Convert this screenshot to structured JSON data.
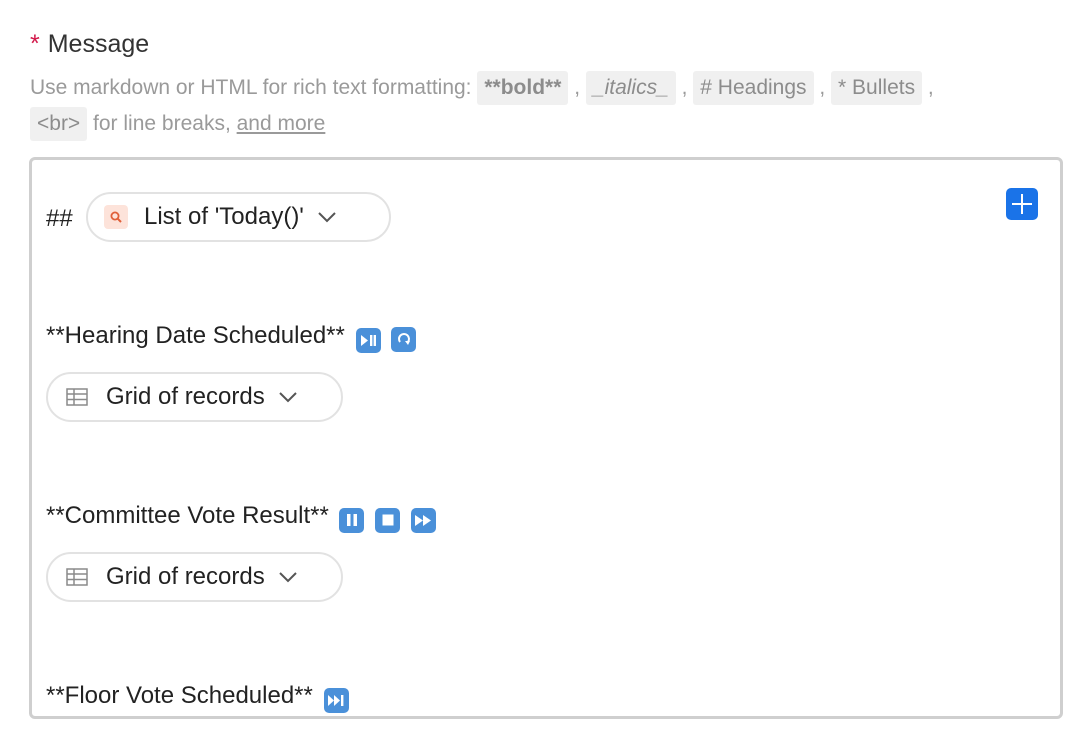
{
  "field": {
    "required_mark": "*",
    "label": "Message",
    "help_prefix": "Use markdown or HTML for rich text formatting:",
    "codes": [
      "**bold**",
      "_italics_",
      "# Headings",
      "* Bullets",
      "<br>"
    ],
    "help_breaks": "for line breaks,",
    "help_link": "and more"
  },
  "editor": {
    "heading_prefix": "##",
    "heading_chip": {
      "label": "List of 'Today()'",
      "icon": "search-icon"
    },
    "sections": [
      {
        "title": "**Hearing Date Scheduled**",
        "emojis": [
          "play-pause-icon",
          "repeat-icon"
        ],
        "chip_label": "Grid of records",
        "chip_icon": "grid-icon"
      },
      {
        "title": "**Committee Vote Result**",
        "emojis": [
          "pause-icon",
          "stop-icon",
          "fast-forward-icon"
        ],
        "chip_label": "Grid of records",
        "chip_icon": "grid-icon"
      },
      {
        "title": "**Floor Vote Scheduled**",
        "emojis": [
          "next-track-icon"
        ]
      }
    ],
    "accent_color": "#1a73e8",
    "emoji_color": "#4a90d9"
  }
}
